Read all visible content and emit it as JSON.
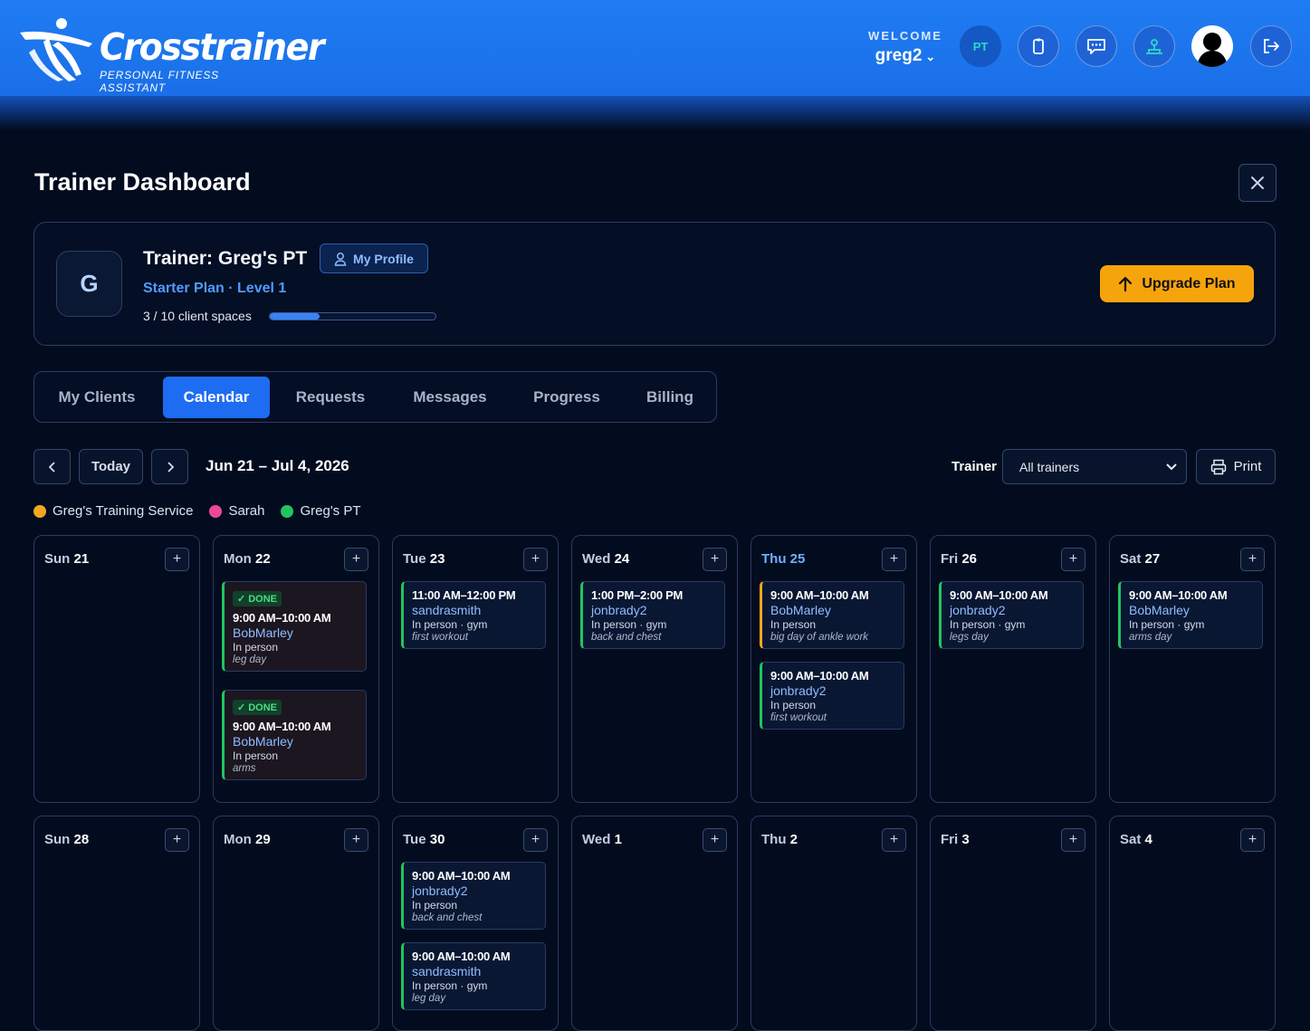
{
  "brand": {
    "name": "Crosstrainer",
    "tagline": "PERSONAL FITNESS ASSISTANT"
  },
  "header": {
    "welcome_label": "WELCOME",
    "username": "greg2",
    "pt_badge": "PT"
  },
  "page": {
    "title": "Trainer Dashboard"
  },
  "profile": {
    "initial": "G",
    "trainer_name": "Trainer: Greg's PT",
    "my_profile_label": "My Profile",
    "plan": "Starter Plan · Level 1",
    "spaces_text": "3 / 10 client spaces",
    "spaces_used": 3,
    "spaces_total": 10,
    "upgrade_label": "Upgrade Plan"
  },
  "tabs": [
    {
      "label": "My Clients",
      "active": false
    },
    {
      "label": "Calendar",
      "active": true
    },
    {
      "label": "Requests",
      "active": false
    },
    {
      "label": "Messages",
      "active": false
    },
    {
      "label": "Progress",
      "active": false
    },
    {
      "label": "Billing",
      "active": false
    }
  ],
  "calendar": {
    "today_label": "Today",
    "range": "Jun 21 – Jul 4, 2026",
    "trainer_label": "Trainer",
    "trainer_select": "All trainers",
    "print_label": "Print",
    "legend": [
      {
        "name": "Greg's Training Service",
        "color": "#f5a623"
      },
      {
        "name": "Sarah",
        "color": "#ec4899"
      },
      {
        "name": "Greg's PT",
        "color": "#22c55e"
      }
    ],
    "done_label": "DONE",
    "days": [
      {
        "dow": "Sun",
        "num": "21",
        "today": false,
        "events": []
      },
      {
        "dow": "Mon",
        "num": "22",
        "today": false,
        "events": [
          {
            "done": true,
            "time": "9:00 AM–10:00 AM",
            "client": "BobMarley",
            "location": "In person",
            "note": "leg day",
            "color": "green"
          },
          {
            "done": true,
            "time": "9:00 AM–10:00 AM",
            "client": "BobMarley",
            "location": "In person",
            "note": "arms",
            "color": "green"
          }
        ]
      },
      {
        "dow": "Tue",
        "num": "23",
        "today": false,
        "events": [
          {
            "done": false,
            "time": "11:00 AM–12:00 PM",
            "client": "sandrasmith",
            "location": "In person · gym",
            "note": "first workout",
            "color": "green"
          }
        ]
      },
      {
        "dow": "Wed",
        "num": "24",
        "today": false,
        "events": [
          {
            "done": false,
            "time": "1:00 PM–2:00 PM",
            "client": "jonbrady2",
            "location": "In person · gym",
            "note": "back and chest",
            "color": "green"
          }
        ]
      },
      {
        "dow": "Thu",
        "num": "25",
        "today": true,
        "events": [
          {
            "done": false,
            "time": "9:00 AM–10:00 AM",
            "client": "BobMarley",
            "location": "In person",
            "note": "big day of ankle work",
            "color": "orange"
          },
          {
            "done": false,
            "time": "9:00 AM–10:00 AM",
            "client": "jonbrady2",
            "location": "In person",
            "note": "first workout",
            "color": "green"
          }
        ]
      },
      {
        "dow": "Fri",
        "num": "26",
        "today": false,
        "events": [
          {
            "done": false,
            "time": "9:00 AM–10:00 AM",
            "client": "jonbrady2",
            "location": "In person · gym",
            "note": "legs day",
            "color": "green"
          }
        ]
      },
      {
        "dow": "Sat",
        "num": "27",
        "today": false,
        "events": [
          {
            "done": false,
            "time": "9:00 AM–10:00 AM",
            "client": "BobMarley",
            "location": "In person · gym",
            "note": "arms day",
            "color": "green"
          }
        ]
      },
      {
        "dow": "Sun",
        "num": "28",
        "today": false,
        "events": []
      },
      {
        "dow": "Mon",
        "num": "29",
        "today": false,
        "events": []
      },
      {
        "dow": "Tue",
        "num": "30",
        "today": false,
        "events": [
          {
            "done": false,
            "time": "9:00 AM–10:00 AM",
            "client": "jonbrady2",
            "location": "In person",
            "note": "back and chest",
            "color": "green"
          },
          {
            "done": false,
            "time": "9:00 AM–10:00 AM",
            "client": "sandrasmith",
            "location": "In person · gym",
            "note": "leg day",
            "color": "green"
          }
        ]
      },
      {
        "dow": "Wed",
        "num": "1",
        "today": false,
        "events": []
      },
      {
        "dow": "Thu",
        "num": "2",
        "today": false,
        "events": []
      },
      {
        "dow": "Fri",
        "num": "3",
        "today": false,
        "events": []
      },
      {
        "dow": "Sat",
        "num": "4",
        "today": false,
        "events": []
      }
    ]
  }
}
